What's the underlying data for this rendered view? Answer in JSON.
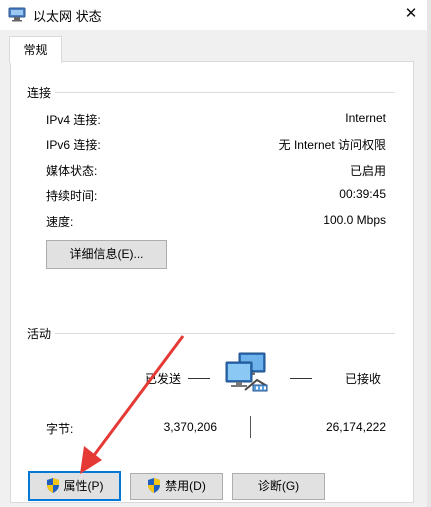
{
  "window": {
    "title": "以太网 状态",
    "close_glyph": "✕"
  },
  "tabs": [
    {
      "label": "常规"
    }
  ],
  "connection": {
    "group_label": "连接",
    "rows": [
      {
        "label": "IPv4 连接:",
        "value": "Internet"
      },
      {
        "label": "IPv6 连接:",
        "value": "无 Internet 访问权限"
      },
      {
        "label": "媒体状态:",
        "value": "已启用"
      },
      {
        "label": "持续时间:",
        "value": "00:39:45"
      },
      {
        "label": "速度:",
        "value": "100.0 Mbps"
      }
    ],
    "details_button": "详细信息(E)..."
  },
  "activity": {
    "group_label": "活动",
    "sent_label": "已发送",
    "received_label": "已接收",
    "bytes_label": "字节:",
    "bytes_sent": "3,370,206",
    "bytes_received": "26,174,222"
  },
  "buttons": {
    "properties": "属性(P)",
    "disable": "禁用(D)",
    "diagnose": "诊断(G)"
  },
  "icons": {
    "title": "network-adapter-icon",
    "activity": "network-computers-icon",
    "shield": "uac-shield-icon"
  },
  "colors": {
    "annotation_arrow": "#e53935",
    "focus_border": "#0078d7",
    "dialog_bg": "#f0f0f0"
  }
}
